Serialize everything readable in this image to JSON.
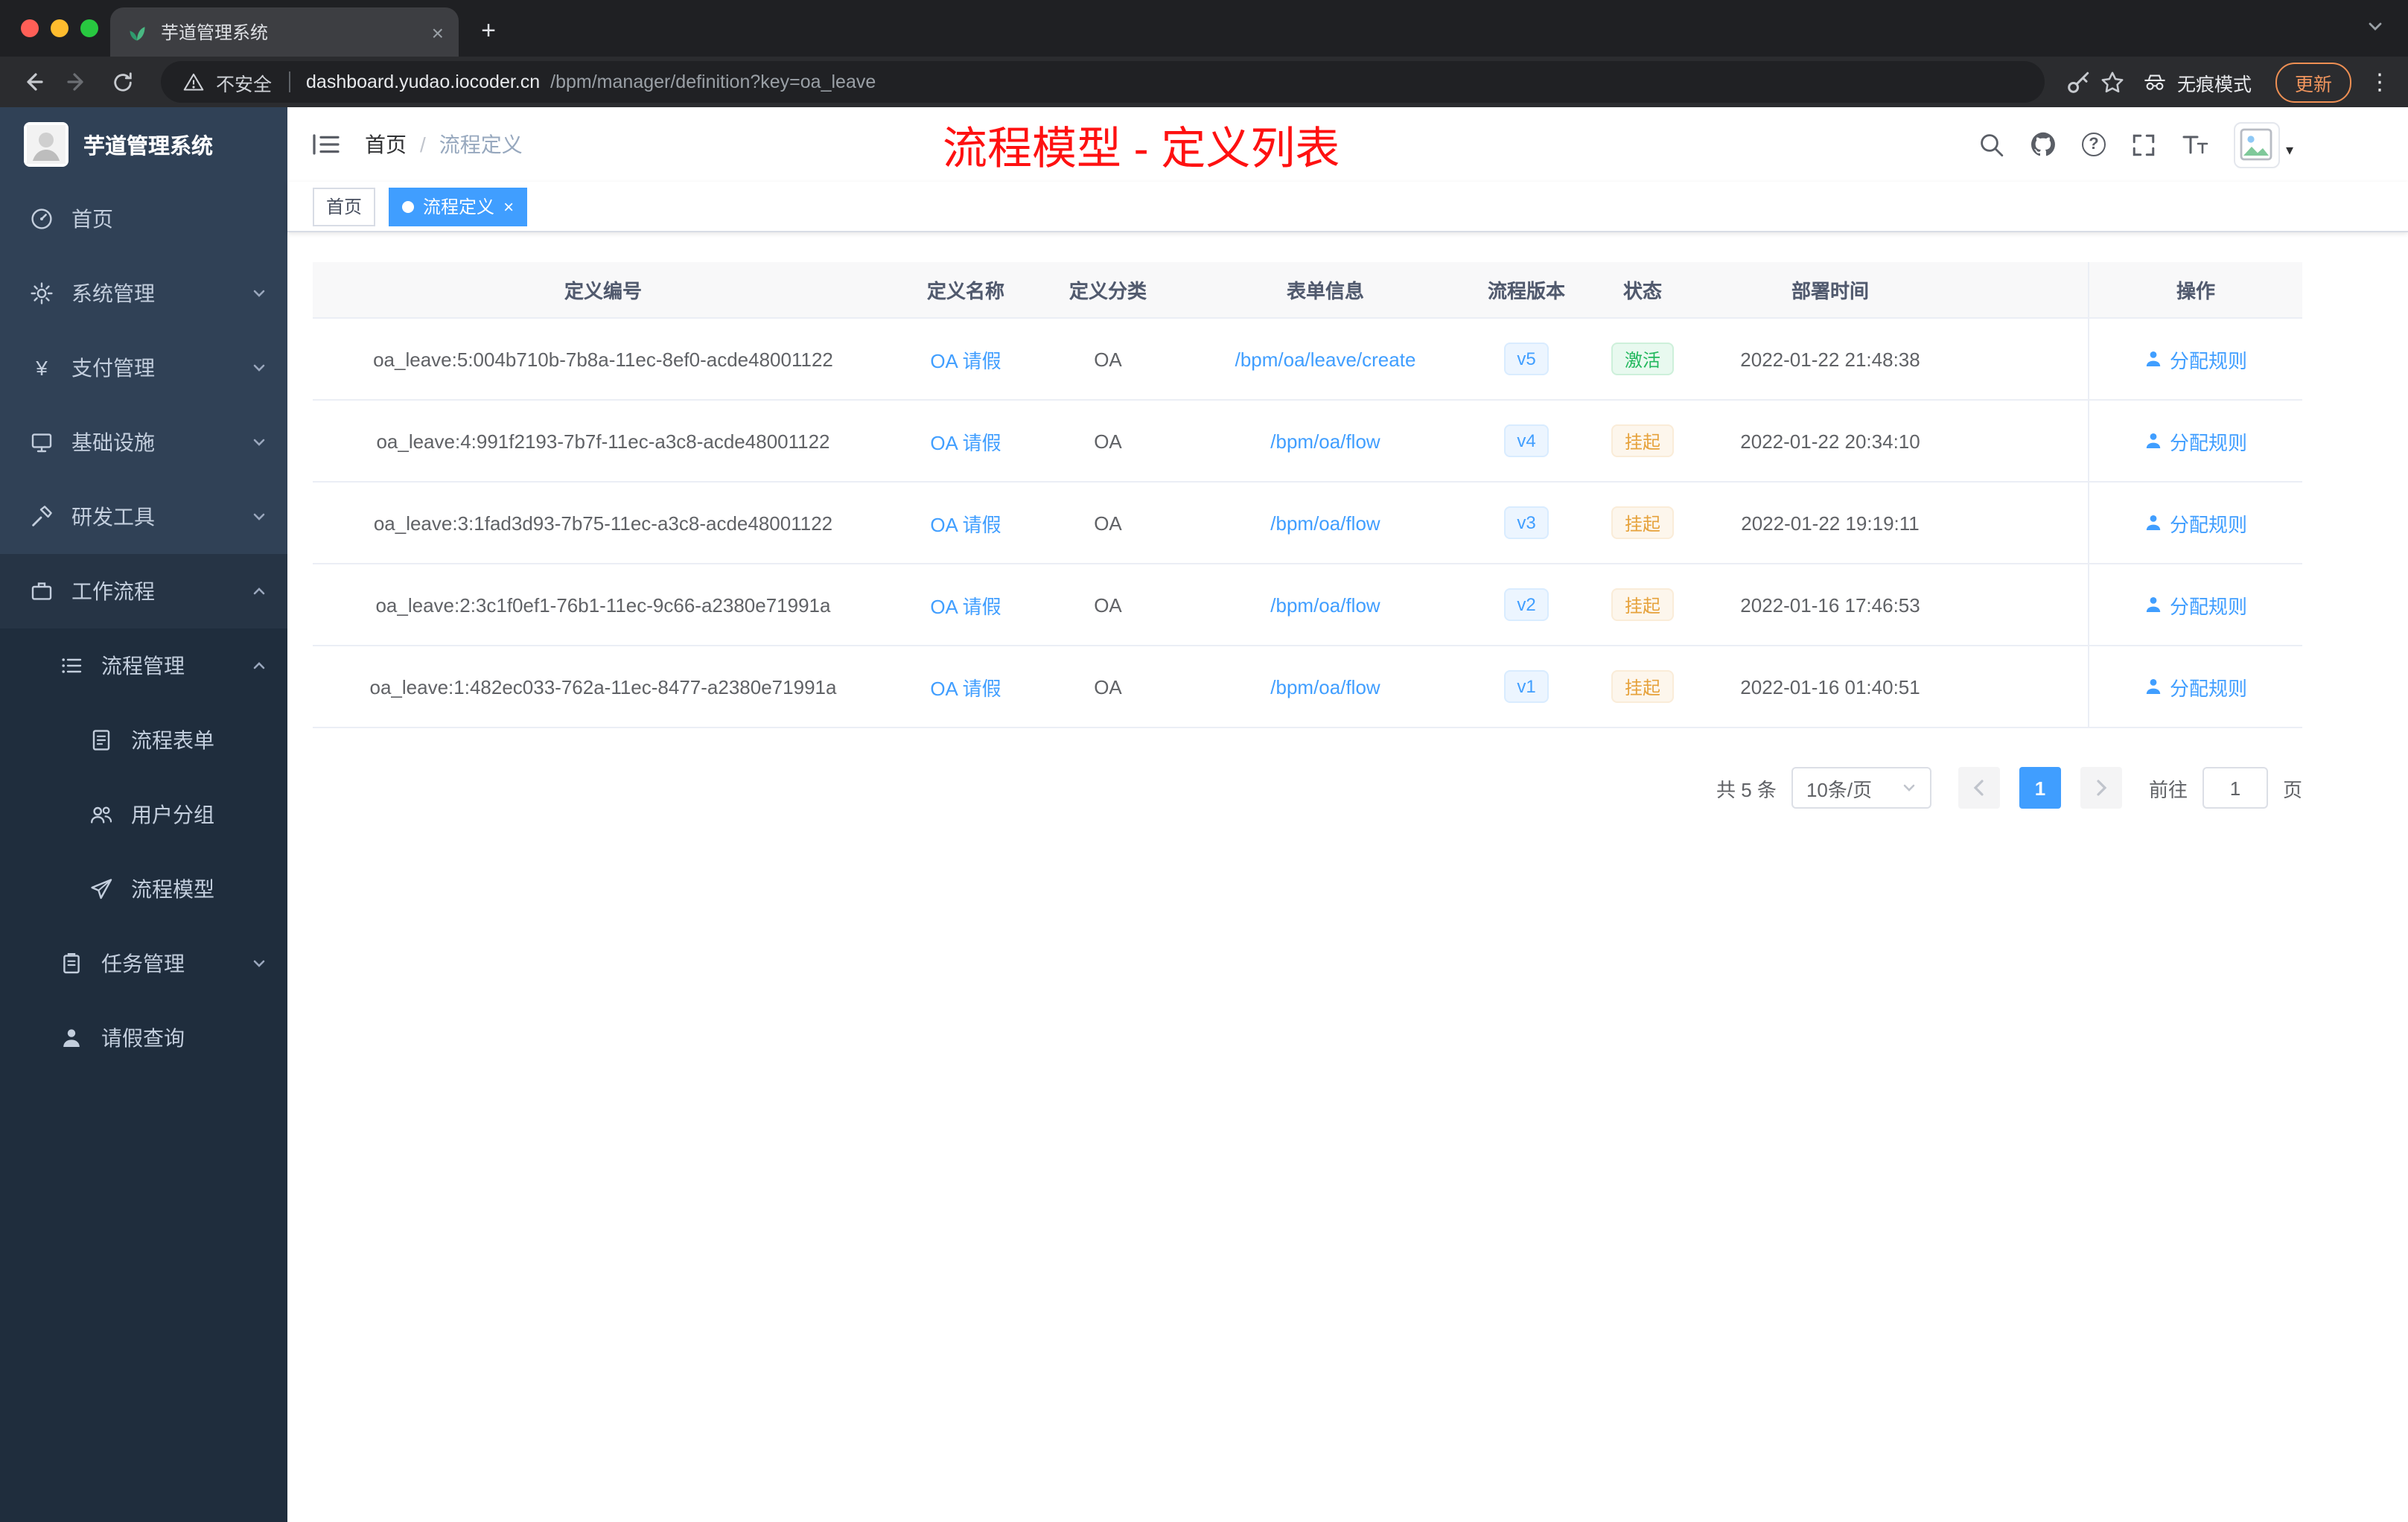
{
  "icons": {
    "close": "×",
    "new_tab": "+",
    "kebab": "⋮",
    "caret": "▾",
    "question": "?",
    "slash": "/"
  },
  "browser": {
    "tab_title": "芋道管理系统",
    "security_label": "不安全",
    "url_host": "dashboard.yudao.iocoder.cn",
    "url_path": "/bpm/manager/definition?key=oa_leave",
    "incognito_label": "无痕模式",
    "update_label": "更新"
  },
  "sidebar": {
    "logo_title": "芋道管理系统",
    "items": [
      {
        "label": "首页"
      },
      {
        "label": "系统管理"
      },
      {
        "label": "支付管理"
      },
      {
        "label": "基础设施"
      },
      {
        "label": "研发工具"
      },
      {
        "label": "工作流程"
      },
      {
        "label": "流程管理"
      },
      {
        "label": "流程表单"
      },
      {
        "label": "用户分组"
      },
      {
        "label": "流程模型"
      },
      {
        "label": "任务管理"
      },
      {
        "label": "请假查询"
      }
    ]
  },
  "header": {
    "breadcrumb_home": "首页",
    "breadcrumb_current": "流程定义",
    "annotation": "流程模型 - 定义列表"
  },
  "tags_view": {
    "items": [
      {
        "label": "首页"
      },
      {
        "label": "流程定义"
      }
    ]
  },
  "table": {
    "columns": [
      "定义编号",
      "定义名称",
      "定义分类",
      "表单信息",
      "流程版本",
      "状态",
      "部署时间",
      "操作"
    ],
    "rows": [
      {
        "id": "oa_leave:5:004b710b-7b8a-11ec-8ef0-acde48001122",
        "name": "OA 请假",
        "category": "OA",
        "form": "/bpm/oa/leave/create",
        "version": "v5",
        "status": "激活",
        "deploy_time": "2022-01-22 21:48:38",
        "action": "分配规则"
      },
      {
        "id": "oa_leave:4:991f2193-7b7f-11ec-a3c8-acde48001122",
        "name": "OA 请假",
        "category": "OA",
        "form": "/bpm/oa/flow",
        "version": "v4",
        "status": "挂起",
        "deploy_time": "2022-01-22 20:34:10",
        "action": "分配规则"
      },
      {
        "id": "oa_leave:3:1fad3d93-7b75-11ec-a3c8-acde48001122",
        "name": "OA 请假",
        "category": "OA",
        "form": "/bpm/oa/flow",
        "version": "v3",
        "status": "挂起",
        "deploy_time": "2022-01-22 19:19:11",
        "action": "分配规则"
      },
      {
        "id": "oa_leave:2:3c1f0ef1-76b1-11ec-9c66-a2380e71991a",
        "name": "OA 请假",
        "category": "OA",
        "form": "/bpm/oa/flow",
        "version": "v2",
        "status": "挂起",
        "deploy_time": "2022-01-16 17:46:53",
        "action": "分配规则"
      },
      {
        "id": "oa_leave:1:482ec033-762a-11ec-8477-a2380e71991a",
        "name": "OA 请假",
        "category": "OA",
        "form": "/bpm/oa/flow",
        "version": "v1",
        "status": "挂起",
        "deploy_time": "2022-01-16 01:40:51",
        "action": "分配规则"
      }
    ]
  },
  "pagination": {
    "total_label": "共 5 条",
    "page_size_label": "10条/页",
    "current_page": "1",
    "goto_label": "前往",
    "goto_value": "1",
    "unit_label": "页"
  },
  "colors": {
    "accent_blue": "#409eff",
    "success_green": "#23b85e",
    "warning_orange": "#e6a23c",
    "annotation_red": "#fe1111",
    "sidebar_bg": "#304156",
    "sidebar_sub_bg": "#1f2d3d"
  }
}
